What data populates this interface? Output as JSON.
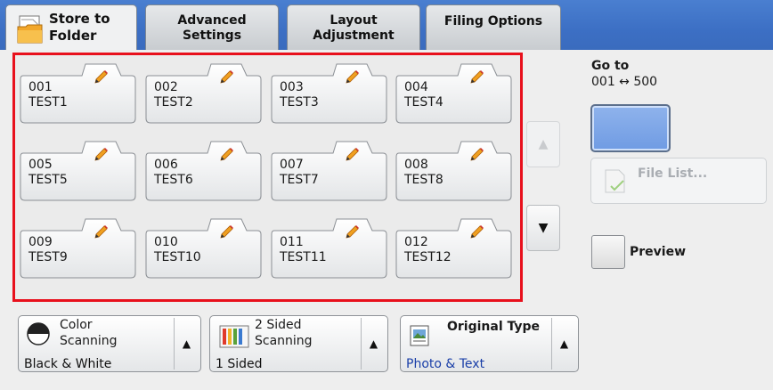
{
  "tabs": [
    {
      "label_line1": "Store to",
      "label_line2": "Folder",
      "active": true
    },
    {
      "label_line1": "Advanced",
      "label_line2": "Settings"
    },
    {
      "label_line1": "Layout",
      "label_line2": "Adjustment"
    },
    {
      "label_line1": "Filing Options",
      "label_line2": ""
    }
  ],
  "mailboxes": [
    {
      "number": "001",
      "name": "TEST1"
    },
    {
      "number": "002",
      "name": "TEST2"
    },
    {
      "number": "003",
      "name": "TEST3"
    },
    {
      "number": "004",
      "name": "TEST4"
    },
    {
      "number": "005",
      "name": "TEST5"
    },
    {
      "number": "006",
      "name": "TEST6"
    },
    {
      "number": "007",
      "name": "TEST7"
    },
    {
      "number": "008",
      "name": "TEST8"
    },
    {
      "number": "009",
      "name": "TEST9"
    },
    {
      "number": "010",
      "name": "TEST10"
    },
    {
      "number": "011",
      "name": "TEST11"
    },
    {
      "number": "012",
      "name": "TEST12"
    }
  ],
  "scroll": {
    "up": "▲",
    "down": "▼"
  },
  "goto": {
    "label": "Go to",
    "range": "001 ↔ 500",
    "value": ""
  },
  "file_list": {
    "label": "File List..."
  },
  "preview": {
    "label": "Preview",
    "checked": false
  },
  "settings": {
    "color": {
      "title_line1": "Color",
      "title_line2": "Scanning",
      "value": "Black & White",
      "arrow": "▲"
    },
    "sided": {
      "title_line1": "2 Sided",
      "title_line2": "Scanning",
      "value": "1 Sided",
      "arrow": "▲"
    },
    "original": {
      "title": "Original Type",
      "value": "Photo & Text",
      "arrow": "▲"
    }
  },
  "colors": {
    "highlight_border": "#e8101c",
    "tab_bar": "#3c6fc4",
    "goto_field": "#7aa4e8",
    "value_blue": "#1a3fa8"
  }
}
